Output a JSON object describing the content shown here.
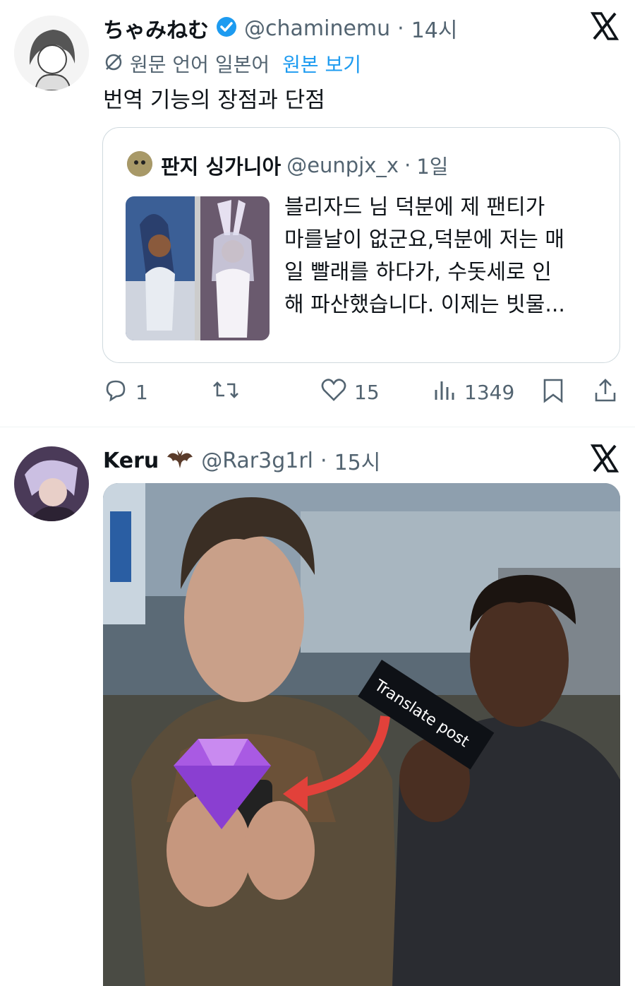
{
  "tweet1": {
    "display_name": "ちゃみねむ",
    "handle": "@chaminemu",
    "sep": "·",
    "time": "14시",
    "verified_icon": "verified-badge-icon",
    "translation_note": "원문 언어 일본어",
    "view_original": "원본 보기",
    "text": "번역 기능의 장점과 단점",
    "quote": {
      "display_name": "판지 싱가니아",
      "handle": "@eunpjx_x",
      "sep": "·",
      "time": "1일",
      "text_lines": [
        "블리자드 님 덕분에 제 팬티가",
        "마를날이 없군요,덕분에 저는 매",
        "일 빨래를 하다가, 수돗세로 인",
        "해 파산했습니다. 이제는 빗물..."
      ]
    },
    "actions": {
      "replies": "1",
      "likes": "15",
      "views": "1349"
    }
  },
  "tweet2": {
    "display_name": "Keru",
    "handle": "@Rar3g1rl",
    "sep": "·",
    "time": "15시",
    "emoji_icon": "bat-icon",
    "media_sign_text": "Translate post"
  },
  "colors": {
    "link": "#1d9bf0",
    "muted": "#536471",
    "border": "#cfd9de"
  }
}
